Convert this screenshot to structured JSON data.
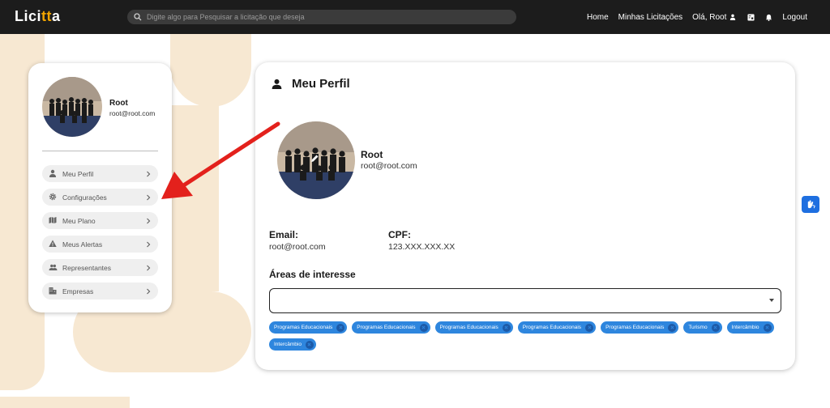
{
  "nav": {
    "logo_main": "Lici",
    "logo_accent": "tt",
    "logo_tail": "a",
    "search_placeholder": "Digite algo para Pesquisar a licitação que deseja",
    "home": "Home",
    "my_bids": "Minhas Licitações",
    "greeting": "Olá, Root",
    "logout": "Logout"
  },
  "sidebar": {
    "name": "Root",
    "email": "root@root.com",
    "items": [
      {
        "label": "Meu Perfil",
        "icon": "person-icon"
      },
      {
        "label": "Configurações",
        "icon": "gear-icon"
      },
      {
        "label": "Meu Plano",
        "icon": "map-icon"
      },
      {
        "label": "Meus Alertas",
        "icon": "warning-icon"
      },
      {
        "label": "Representantes",
        "icon": "group-icon"
      },
      {
        "label": "Empresas",
        "icon": "building-icon"
      }
    ]
  },
  "profile": {
    "title": "Meu Perfil",
    "name": "Root",
    "email": "root@root.com",
    "email_label": "Email:",
    "email_value": "root@root.com",
    "cpf_label": "CPF:",
    "cpf_value": "123.XXX.XXX.XX",
    "areas_title": "Áreas de interesse",
    "chips": [
      "Programas Educacionais",
      "Programas Educacionais",
      "Programas Educacionais",
      "Programas Educacionais",
      "Programas Educacionais",
      "Turismo",
      "Intercâmbio",
      "Intercâmbio"
    ]
  },
  "colors": {
    "navbar": "#1c1c1c",
    "accent_logo": "#f0a400",
    "chip": "#2e86de",
    "arrow": "#e3211c",
    "bg_shape": "#f7e8d2"
  }
}
